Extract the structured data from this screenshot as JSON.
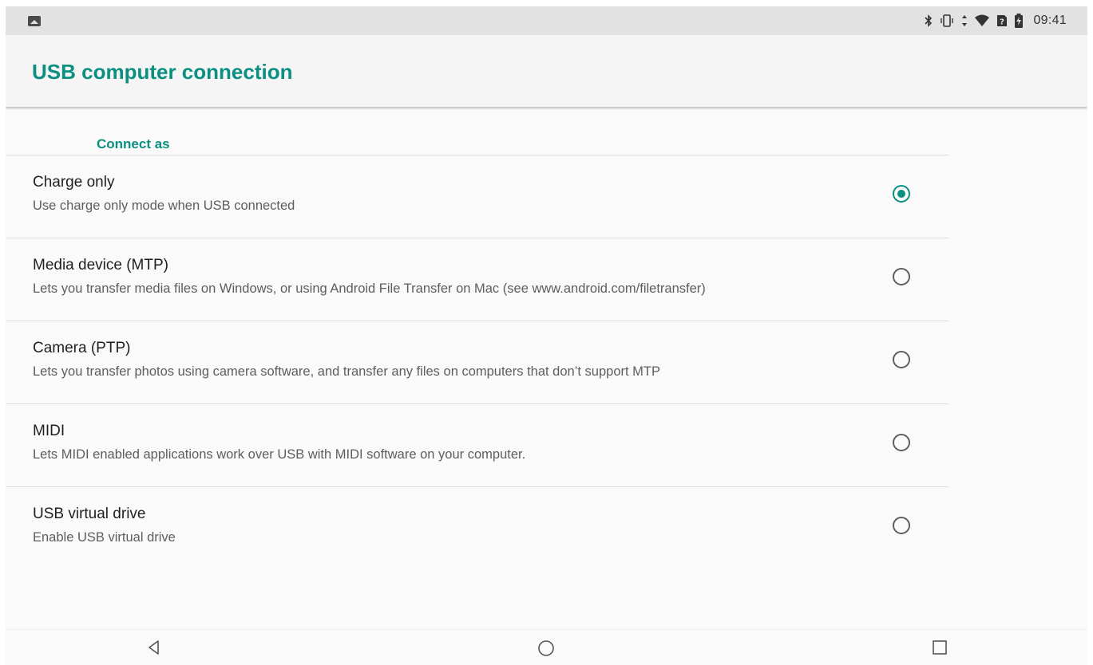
{
  "status_bar": {
    "time": "09:41",
    "left_icon": "gallery-notification-icon",
    "right_icons": [
      "bluetooth-icon",
      "vibrate-icon",
      "data-arrows-icon",
      "wifi-icon",
      "no-sim-icon",
      "battery-charging-icon"
    ]
  },
  "app_bar": {
    "title": "USB computer connection"
  },
  "section": {
    "header": "Connect as"
  },
  "options": [
    {
      "title": "Charge only",
      "subtitle": "Use charge only mode when USB connected",
      "selected": true
    },
    {
      "title": "Media device (MTP)",
      "subtitle": "Lets you transfer media files on Windows, or using Android File Transfer on Mac (see www.android.com/filetransfer)",
      "selected": false
    },
    {
      "title": "Camera (PTP)",
      "subtitle": "Lets you transfer photos using camera software, and transfer any files on computers that don’t support MTP",
      "selected": false
    },
    {
      "title": "MIDI",
      "subtitle": "Lets MIDI enabled applications work over USB with MIDI software on your computer.",
      "selected": false
    },
    {
      "title": "USB virtual drive",
      "subtitle": "Enable USB virtual drive",
      "selected": false
    }
  ],
  "nav_bar": {
    "buttons": [
      "back-icon",
      "home-icon",
      "recents-icon"
    ]
  },
  "colors": {
    "accent": "#0a8f80",
    "status_bar": "#e2e2e2",
    "background": "#fafafa"
  }
}
